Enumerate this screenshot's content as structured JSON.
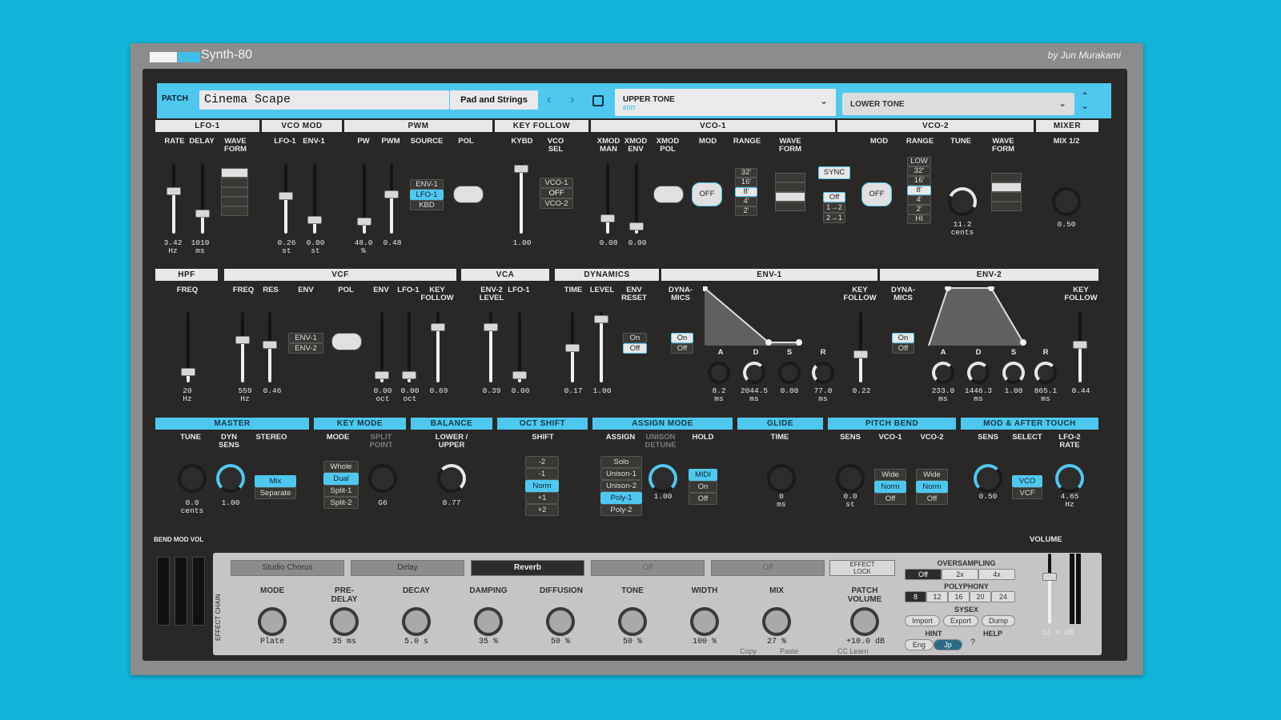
{
  "app": {
    "logo_text": "Synth-80",
    "author": "by Jun Murakami"
  },
  "patch": {
    "label": "PATCH",
    "name": "Cinema Scape",
    "category": "Pad and Strings",
    "upper": "UPPER TONE",
    "upper_sub": "EDIT",
    "lower": "LOWER TONE"
  },
  "sections": {
    "lfo1": "LFO-1",
    "vcomod": "VCO MOD",
    "pwm": "PWM",
    "keyfollow": "KEY FOLLOW",
    "vco1": "VCO-1",
    "vco2": "VCO-2",
    "mixer": "MIXER",
    "hpf": "HPF",
    "vcf": "VCF",
    "vca": "VCA",
    "dynamics": "DYNAMICS",
    "env1": "ENV-1",
    "env2": "ENV-2",
    "master": "MASTER",
    "keymode": "KEY MODE",
    "balance": "BALANCE",
    "octshift": "OCT SHIFT",
    "assign": "ASSIGN MODE",
    "glide": "GLIDE",
    "pitchbend": "PITCH BEND",
    "modafter": "MOD & AFTER TOUCH"
  },
  "lfo1": {
    "rate": "RATE",
    "delay": "DELAY",
    "wave": "WAVE\nFORM",
    "rate_v": "3.42\nHz",
    "delay_v": "1010\nms"
  },
  "vcomod": {
    "lfo1": "LFO-1",
    "env1": "ENV-1",
    "lfo1_v": "0.26\nst",
    "env1_v": "0.00\nst"
  },
  "pwm": {
    "pw": "PW",
    "pwm": "PWM",
    "source": "SOURCE",
    "pol": "POL",
    "pw_v": "48.0\n%",
    "pwm_v": "0.48",
    "src_opts": [
      "ENV-1",
      "LFO-1",
      "KBD"
    ]
  },
  "keyf": {
    "kybd": "KYBD",
    "vcosel": "VCO\nSEL",
    "kybd_v": "1.00",
    "sel_opts": [
      "VCO-1",
      "OFF",
      "VCO-2"
    ]
  },
  "vco1": {
    "xman": "XMOD\nMAN",
    "xenv": "XMOD\nENV",
    "xpol": "XMOD\nPOL",
    "mod": "MOD",
    "range": "RANGE",
    "wave": "WAVE\nFORM",
    "xman_v": "0.08",
    "xenv_v": "0.00",
    "mod_btn": "OFF",
    "range_opts": [
      "32'",
      "16'",
      "8'",
      "4'",
      "2'"
    ]
  },
  "vco2": {
    "mod": "MOD",
    "range": "RANGE",
    "tune": "TUNE",
    "wave": "WAVE\nFORM",
    "sync": "SYNC",
    "sync_opts": [
      "Off",
      "1→2",
      "2→1"
    ],
    "mod_btn": "OFF",
    "range_opts": [
      "LOW",
      "32'",
      "16'",
      "8'",
      "4'",
      "2'",
      "HI"
    ],
    "tune_v": "11.2\ncents"
  },
  "mixer": {
    "mix": "MIX 1/2",
    "mix_v": "0.50"
  },
  "hpf": {
    "freq": "FREQ",
    "freq_v": "20\nHz"
  },
  "vcf": {
    "freq": "FREQ",
    "res": "RES",
    "env": "ENV",
    "pol": "POL",
    "env2": "ENV",
    "lfo1": "LFO-1",
    "keyf": "KEY\nFOLLOW",
    "freq_v": "559\nHz",
    "res_v": "0.46",
    "env_opts": [
      "ENV-1",
      "ENV-2"
    ],
    "env2_v": "0.00\noct",
    "lfo_v": "0.00\noct",
    "keyf_v": "0.69"
  },
  "vca": {
    "env2": "ENV-2\nLEVEL",
    "lfo1": "LFO-1",
    "env2_v": "0.39",
    "lfo_v": "0.00"
  },
  "dyn": {
    "time": "TIME",
    "level": "LEVEL",
    "reset": "ENV\nRESET",
    "time_v": "0.17",
    "level_v": "1.00",
    "reset_opts": [
      "On",
      "Off"
    ]
  },
  "env1": {
    "dyna": "DYNA-\nMICS",
    "keyf": "KEY\nFOLLOW",
    "dyna_opts": [
      "On",
      "Off"
    ],
    "a": "A",
    "d": "D",
    "s": "S",
    "r": "R",
    "a_v": "8.2\nms",
    "d_v": "2044.5\nms",
    "s_v": "0.00",
    "r_v": "77.0\nms",
    "keyf_v": "0.22"
  },
  "env2": {
    "dyna": "DYNA-\nMICS",
    "keyf": "KEY\nFOLLOW",
    "dyna_opts": [
      "On",
      "Off"
    ],
    "a": "A",
    "d": "D",
    "s": "S",
    "r": "R",
    "a_v": "233.0\nms",
    "d_v": "1446.3\nms",
    "s_v": "1.00",
    "r_v": "865.1\nms",
    "keyf_v": "0.44"
  },
  "master": {
    "tune": "TUNE",
    "dyn": "DYN\nSENS",
    "stereo": "STEREO",
    "tune_v": "0.0\ncents",
    "dyn_v": "1.00",
    "stereo_opts": [
      "Mix",
      "Separate"
    ]
  },
  "keymode": {
    "mode": "MODE",
    "split": "SPLIT\nPOINT",
    "opts": [
      "Whole",
      "Dual",
      "Split-1",
      "Split-2"
    ],
    "split_v": "G6"
  },
  "balance": {
    "lbl": "LOWER /\nUPPER",
    "v": "0.77"
  },
  "octshift": {
    "lbl": "SHIFT",
    "opts": [
      "-2",
      "-1",
      "Norm",
      "+1",
      "+2"
    ]
  },
  "assign": {
    "assign": "ASSIGN",
    "unison": "UNISON\nDETUNE",
    "hold": "HOLD",
    "opts": [
      "Solo",
      "Unison-1",
      "Unison-2",
      "Poly-1",
      "Poly-2"
    ],
    "unison_v": "1.00",
    "hold_opts": [
      "MIDI",
      "On",
      "Off"
    ]
  },
  "glide": {
    "time": "TIME",
    "v": "0\nms"
  },
  "pitchbend": {
    "sens": "SENS",
    "vco1": "VCO-1",
    "vco2": "VCO-2",
    "sens_v": "0.0\nst",
    "opts": [
      "Wide",
      "Norm",
      "Off"
    ]
  },
  "modafter": {
    "sens": "SENS",
    "select": "SELECT",
    "lfo2": "LFO-2\nRATE",
    "sens_v": "0.50",
    "select_opts": [
      "VCO",
      "VCF"
    ],
    "lfo2_v": "4.65\nHz"
  },
  "bottom": {
    "bmv": "BEND MOD VOL",
    "chain": "EFFECT CHAIN",
    "slots": [
      "Studio Chorus",
      "Delay",
      "Reverb",
      "Off",
      "Off"
    ],
    "effect_lock": "EFFECT\nLOCK",
    "params": [
      {
        "l": "MODE",
        "v": "Plate"
      },
      {
        "l": "PRE-\nDELAY",
        "v": "35 ms"
      },
      {
        "l": "DECAY",
        "v": "5.0 s"
      },
      {
        "l": "DAMPING",
        "v": "35 %"
      },
      {
        "l": "DIFFUSION",
        "v": "50 %"
      },
      {
        "l": "TONE",
        "v": "50 %"
      },
      {
        "l": "WIDTH",
        "v": "100 %"
      },
      {
        "l": "MIX",
        "v": "27 %"
      }
    ],
    "patch_vol": "PATCH\nVOLUME",
    "patch_vol_v": "+10.0 dB",
    "copy": "Copy",
    "paste": "Paste",
    "cclearn": "CC Learn",
    "oversampling": "OVERSAMPLING",
    "os_opts": [
      "Off",
      "2x",
      "4x"
    ],
    "polyphony": "POLYPHONY",
    "poly_opts": [
      "8",
      "12",
      "16",
      "20",
      "24"
    ],
    "sysex": "SYSEX",
    "sysex_opts": [
      "Import",
      "Export",
      "Dump"
    ],
    "hint": "HINT",
    "help": "HELP",
    "hint_opts": [
      "Eng",
      "Jp"
    ],
    "volume": "VOLUME",
    "volume_v": "-12.0 dB"
  }
}
